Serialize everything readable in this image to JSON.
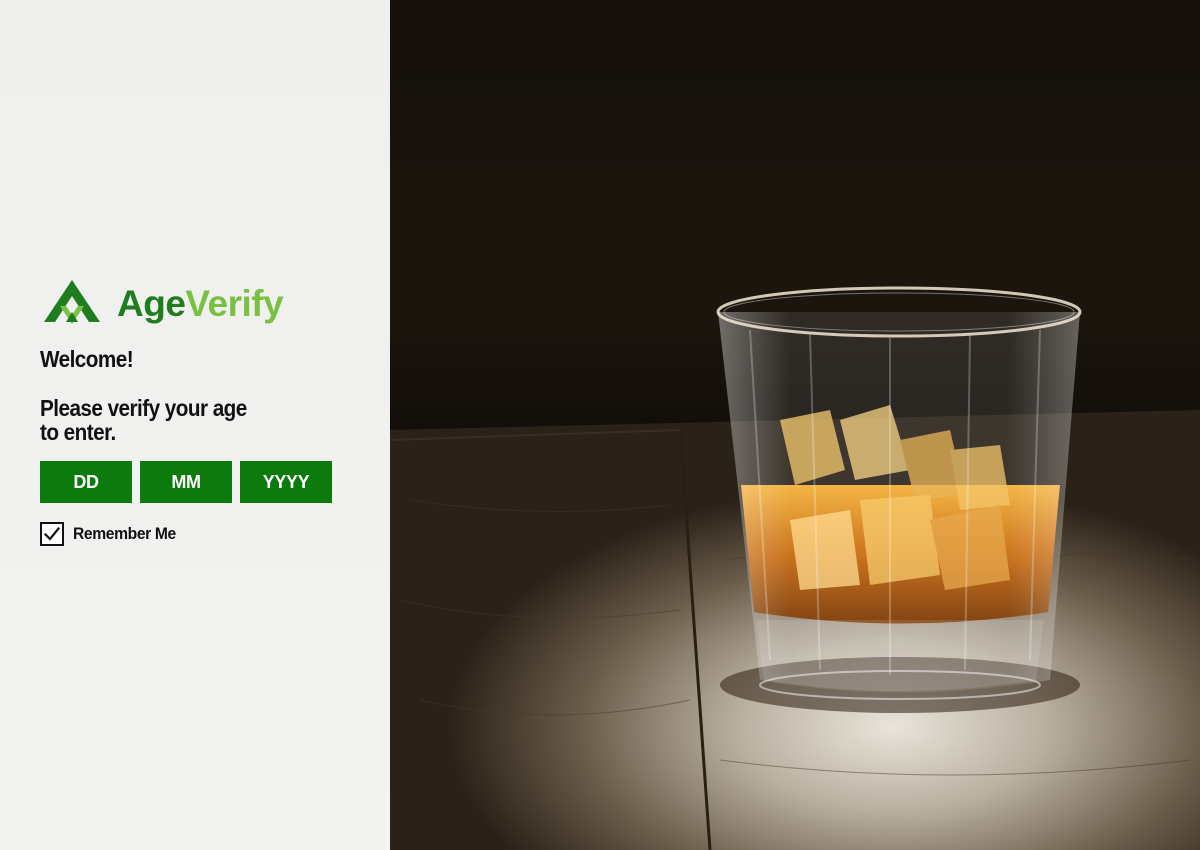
{
  "brand": {
    "name_part1": "Age",
    "name_part2": "Verify",
    "logo_icon": "age-verify-logo-icon",
    "colors": {
      "dark_green": "#1e7d1e",
      "light_green": "#7ac143",
      "field_green": "#0d7a0d"
    }
  },
  "panel": {
    "welcome": "Welcome!",
    "prompt": "Please verify your age to enter."
  },
  "dob": {
    "day": {
      "placeholder": "DD",
      "value": ""
    },
    "month": {
      "placeholder": "MM",
      "value": ""
    },
    "year": {
      "placeholder": "YYYY",
      "value": ""
    }
  },
  "remember": {
    "label": "Remember Me",
    "checked": true,
    "icon": "checkmark-icon"
  },
  "background": {
    "subject": "whiskey-glass-photo"
  }
}
